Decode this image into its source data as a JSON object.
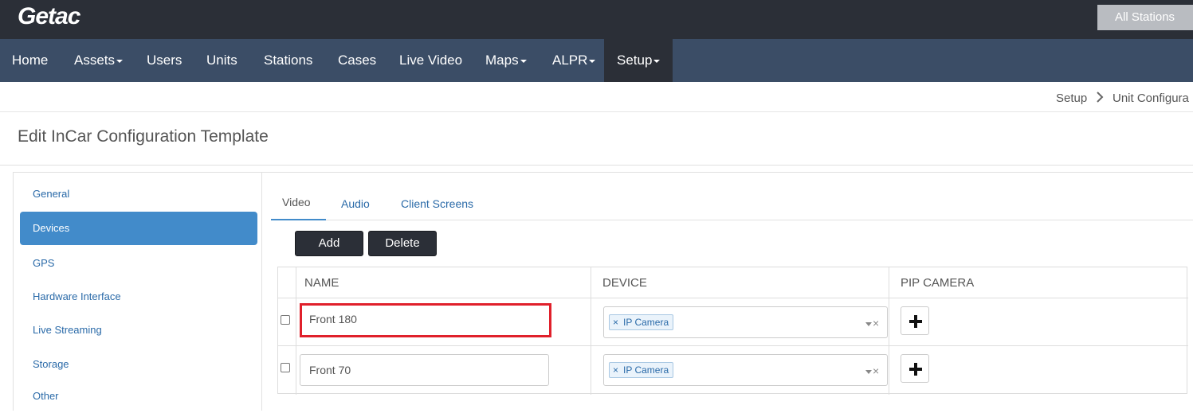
{
  "header": {
    "logo": "Getac",
    "station_selector": "All Stations"
  },
  "nav": {
    "items": [
      {
        "label": "Home",
        "dropdown": false
      },
      {
        "label": "Assets",
        "dropdown": true
      },
      {
        "label": "Users",
        "dropdown": false
      },
      {
        "label": "Units",
        "dropdown": false
      },
      {
        "label": "Stations",
        "dropdown": false
      },
      {
        "label": "Cases",
        "dropdown": false
      },
      {
        "label": "Live Video",
        "dropdown": false
      },
      {
        "label": "Maps",
        "dropdown": true
      },
      {
        "label": "ALPR",
        "dropdown": true
      },
      {
        "label": "Setup",
        "dropdown": true,
        "active": true
      }
    ]
  },
  "breadcrumb": {
    "items": [
      "Setup",
      "Unit Configura"
    ]
  },
  "page": {
    "title": "Edit InCar Configuration Template"
  },
  "sidebar": {
    "items": [
      {
        "label": "General"
      },
      {
        "label": "Devices",
        "active": true
      },
      {
        "label": "GPS"
      },
      {
        "label": "Hardware Interface"
      },
      {
        "label": "Live Streaming"
      },
      {
        "label": "Storage"
      },
      {
        "label": "Other"
      }
    ]
  },
  "tabs": [
    {
      "label": "Video",
      "active": true
    },
    {
      "label": "Audio"
    },
    {
      "label": "Client Screens"
    }
  ],
  "toolbar": {
    "add_label": "Add",
    "delete_label": "Delete"
  },
  "table": {
    "columns": [
      "NAME",
      "DEVICE",
      "PIP CAMERA"
    ],
    "rows": [
      {
        "name": "Front 180",
        "device_tag": "IP Camera",
        "highlighted": true
      },
      {
        "name": "Front 70",
        "device_tag": "IP Camera",
        "highlighted": false
      }
    ]
  },
  "colors": {
    "topbar": "#2b2f37",
    "navbar": "#3b4d66",
    "accent": "#428bca",
    "highlight": "#e0202b"
  }
}
